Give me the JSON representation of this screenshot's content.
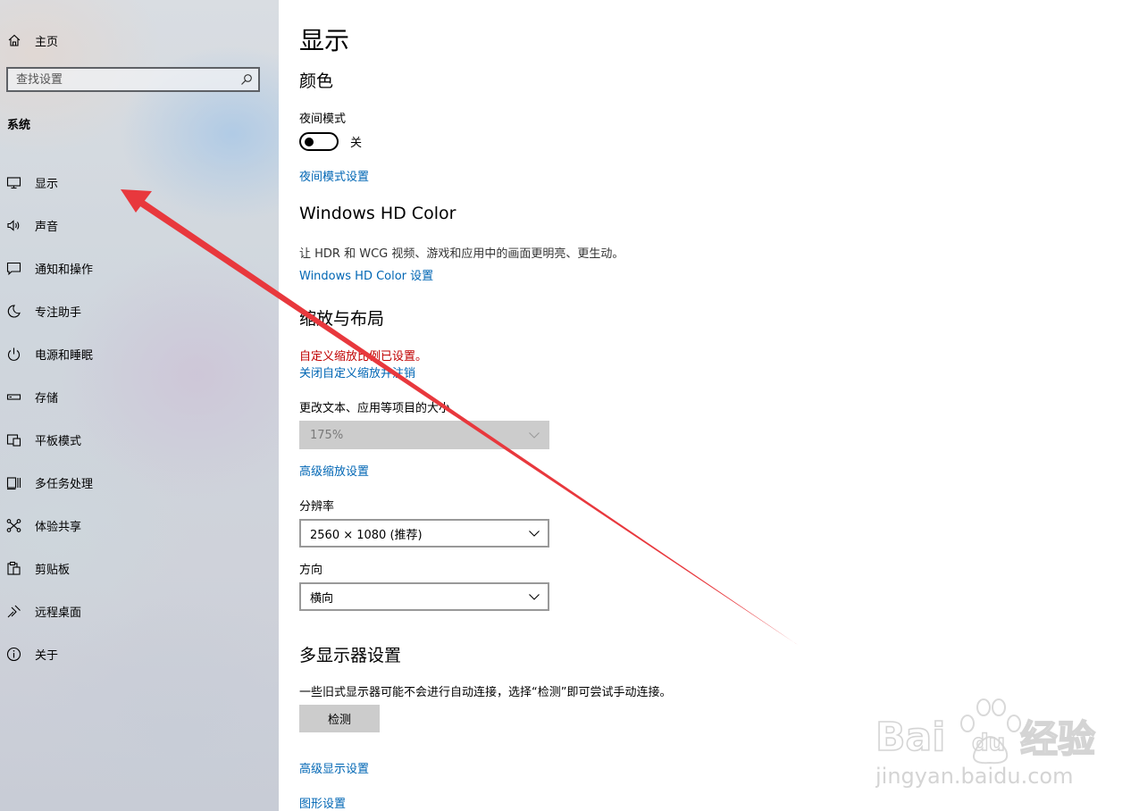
{
  "sidebar": {
    "home_label": "主页",
    "search_placeholder": "查找设置",
    "section_title": "系统",
    "items": [
      {
        "label": "显示",
        "icon": "monitor-icon"
      },
      {
        "label": "声音",
        "icon": "speaker-icon"
      },
      {
        "label": "通知和操作",
        "icon": "notification-icon"
      },
      {
        "label": "专注助手",
        "icon": "moon-icon"
      },
      {
        "label": "电源和睡眠",
        "icon": "power-icon"
      },
      {
        "label": "存储",
        "icon": "storage-icon"
      },
      {
        "label": "平板模式",
        "icon": "tablet-icon"
      },
      {
        "label": "多任务处理",
        "icon": "multitask-icon"
      },
      {
        "label": "体验共享",
        "icon": "share-icon"
      },
      {
        "label": "剪贴板",
        "icon": "clipboard-icon"
      },
      {
        "label": "远程桌面",
        "icon": "remote-desktop-icon"
      },
      {
        "label": "关于",
        "icon": "info-icon"
      }
    ]
  },
  "main": {
    "title": "显示",
    "color_section": {
      "heading": "颜色",
      "night_mode_label": "夜间模式",
      "toggle_state": "关",
      "night_mode_link": "夜间模式设置"
    },
    "hd_color_section": {
      "heading": "Windows HD Color",
      "description": "让 HDR 和 WCG 视频、游戏和应用中的画面更明亮、更生动。",
      "link": "Windows HD Color 设置"
    },
    "scale_section": {
      "heading": "缩放与布局",
      "warning": "自定义缩放比例已设置。",
      "warning_link": "关闭自定义缩放并注销",
      "size_label": "更改文本、应用等项目的大小",
      "size_value": "175%",
      "advanced_link": "高级缩放设置",
      "resolution_label": "分辨率",
      "resolution_value": "2560 × 1080 (推荐)",
      "orientation_label": "方向",
      "orientation_value": "横向"
    },
    "multi_display_section": {
      "heading": "多显示器设置",
      "description": "一些旧式显示器可能不会进行自动连接，选择“检测”即可尝试手动连接。",
      "detect_button": "检测",
      "advanced_display_link": "高级显示设置",
      "graphics_link": "图形设置"
    }
  },
  "watermark": {
    "brand": "Bai",
    "brand_suffix": "du",
    "product": "经验",
    "url": "jingyan.baidu.com"
  },
  "colors": {
    "link": "#0066b4",
    "warning": "#c00000",
    "annotation_arrow": "#e8383d"
  }
}
